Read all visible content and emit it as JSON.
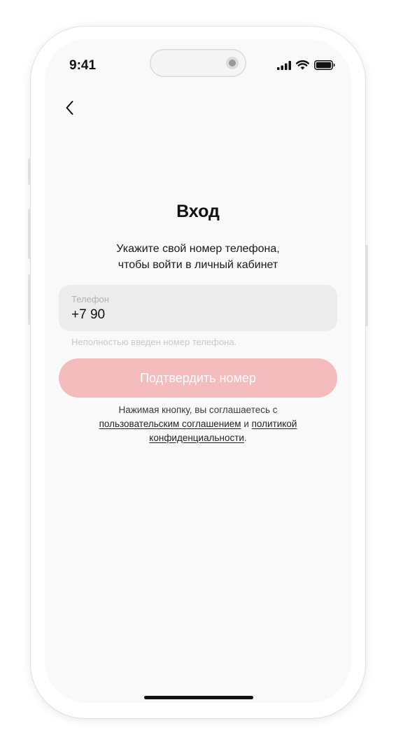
{
  "status_bar": {
    "time": "9:41",
    "icons": [
      "signal-icon",
      "wifi-icon",
      "battery-icon"
    ]
  },
  "nav": {
    "back_icon": "chevron-left-icon"
  },
  "login": {
    "title": "Вход",
    "subtitle_line1": "Укажите свой номер телефона,",
    "subtitle_line2": "чтобы войти в личный кабинет"
  },
  "phone_field": {
    "label": "Телефон",
    "value": "+7 90",
    "error": "Неполностью введен номер телефона."
  },
  "confirm_button": {
    "label": "Подтвердить номер",
    "color": "#F4BCBC"
  },
  "consent": {
    "prefix": "Нажимая кнопку, вы соглашаетесь с",
    "user_agreement_link": "пользовательским соглашением",
    "and": " и ",
    "privacy_link_part1": "политикой",
    "privacy_link_part2": "конфиденциальности",
    "suffix": "."
  }
}
